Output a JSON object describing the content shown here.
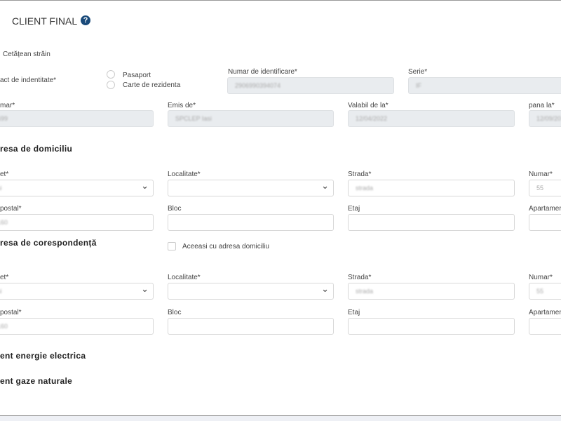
{
  "header": {
    "title": "CLIENT FINAL",
    "help_icon": "question-circle-icon"
  },
  "identity": {
    "foreign_citizen_label": "Cetățean străin",
    "id_type_label": "act de indentitate*",
    "options": [
      "Pasaport",
      "Carte de rezidenta"
    ],
    "id_number": {
      "label": "Numar de identificare*",
      "value": "2906990394074"
    },
    "series": {
      "label": "Serie*",
      "value": "IF"
    },
    "number": {
      "label": "mar*",
      "value": "0699"
    },
    "issued_by": {
      "label": "Emis de*",
      "value": "SPCLEP Iasi"
    },
    "valid_from": {
      "label": "Valabil de la*",
      "value": "12/04/2022"
    },
    "valid_to": {
      "label": "pana la*",
      "value": "12/09/20"
    }
  },
  "domicile": {
    "heading": "resa de domiciliu",
    "county": {
      "label": "et*",
      "value": "asi"
    },
    "locality": {
      "label": "Localitate*",
      "value": ""
    },
    "street": {
      "label": "Strada*",
      "value": "strada"
    },
    "number": {
      "label": "Numar*",
      "value": "55"
    },
    "postal": {
      "label": "postal*",
      "value": "7160"
    },
    "block": {
      "label": "Bloc",
      "value": ""
    },
    "floor": {
      "label": "Etaj",
      "value": ""
    },
    "apartment": {
      "label": "Apartamer",
      "value": ""
    }
  },
  "correspondence": {
    "heading": "resa de corespondență",
    "same_label": "Aceeasi cu adresa domiciliu",
    "county": {
      "label": "et*",
      "value": "asi"
    },
    "locality": {
      "label": "Localitate*",
      "value": ""
    },
    "street": {
      "label": "Strada*",
      "value": "strada"
    },
    "number": {
      "label": "Numar*",
      "value": "55"
    },
    "postal": {
      "label": "postal*",
      "value": "7160"
    },
    "block": {
      "label": "Bloc",
      "value": ""
    },
    "floor": {
      "label": "Etaj",
      "value": ""
    },
    "apartment": {
      "label": "Apartamer",
      "value": ""
    }
  },
  "sections": {
    "energy": "ent energie electrica",
    "gas": "ent gaze naturale"
  }
}
